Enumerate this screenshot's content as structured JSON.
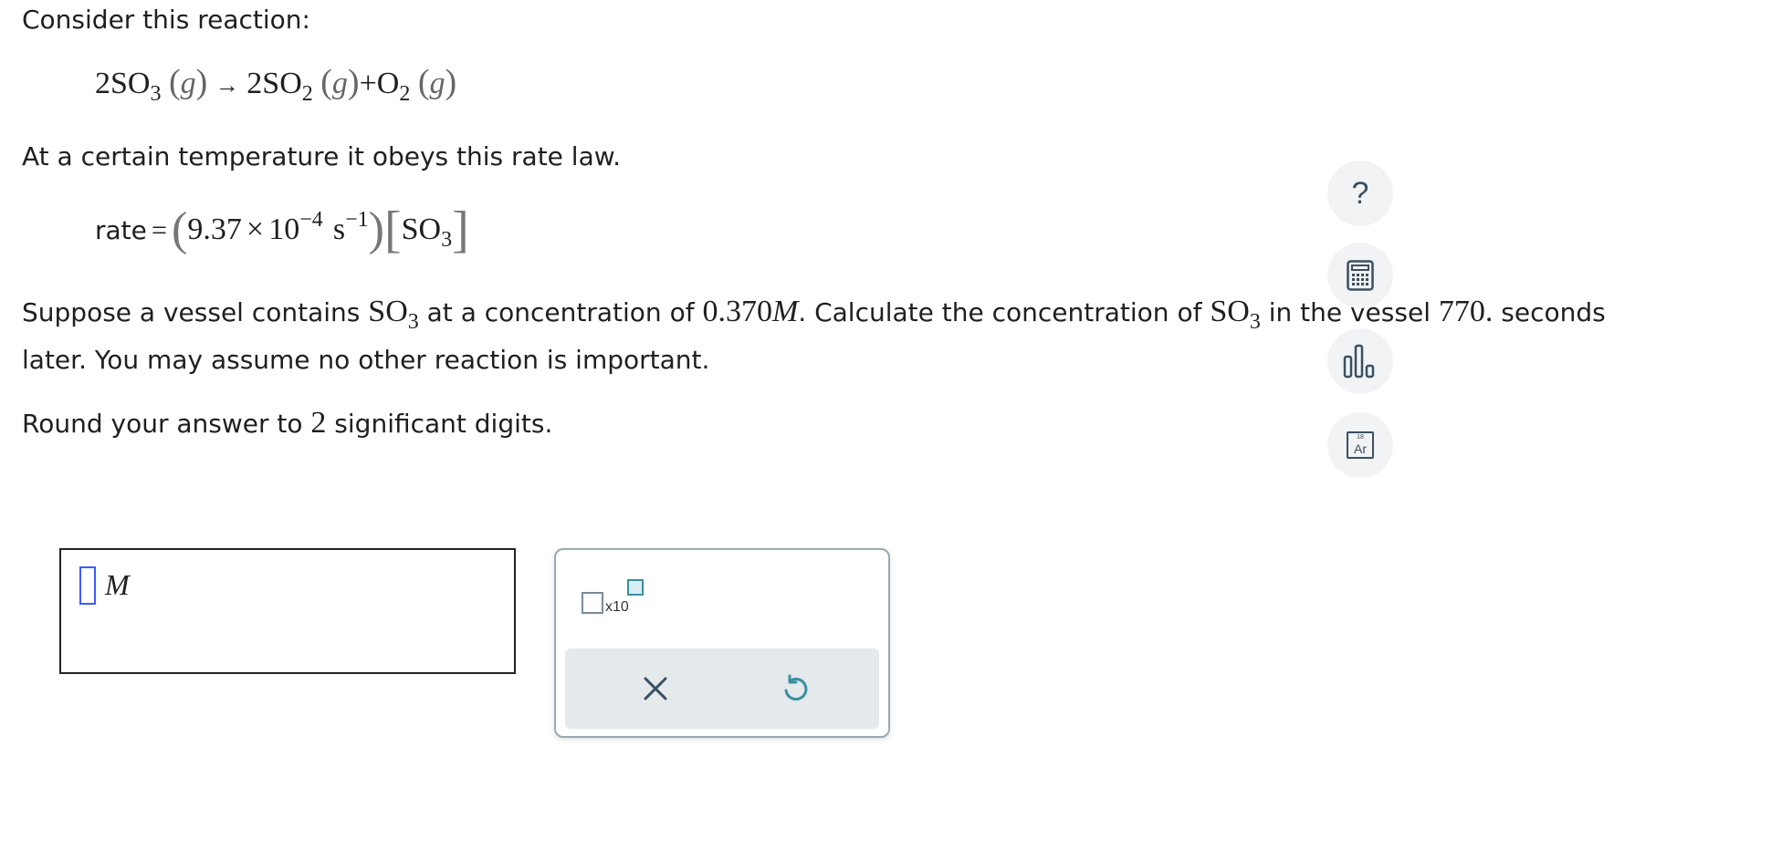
{
  "intro": "Consider this reaction:",
  "reaction": {
    "r_coef": "2",
    "r_species": "SO",
    "r_sub": "3",
    "phase": "g",
    "arrow": "→",
    "p1_coef": "2",
    "p1_species": "SO",
    "p1_sub": "2",
    "plus": "+",
    "p2_species": "O",
    "p2_sub": "2"
  },
  "rate_intro": "At a certain temperature it obeys this rate law.",
  "rate_law": {
    "label": "rate",
    "equals": "=",
    "k_mantissa": "9.37",
    "times": "×",
    "ten": "10",
    "k_exp": "−4",
    "unit": "s",
    "unit_exp": "−1",
    "species": "SO",
    "species_sub": "3"
  },
  "question": {
    "p1": "Suppose a vessel contains ",
    "species": "SO",
    "species_sub": "3",
    "p2": " at a concentration of ",
    "conc": "0.370",
    "conc_unit": "M",
    "p3": ". Calculate the concentration of ",
    "p4": " in the vessel ",
    "time": "770.",
    "p5": " seconds",
    "line2": "later. You may assume no other reaction is important."
  },
  "rounding": {
    "p1": "Round your answer to ",
    "digits": "2",
    "p2": " significant digits."
  },
  "answer": {
    "value": "",
    "unit": "M"
  },
  "palette": {
    "sci_label": "x10"
  },
  "tools": {
    "help": "?",
    "periodic_number": "18",
    "periodic_symbol": "Ar"
  },
  "colors": {
    "accent_cursor": "#3d5afe",
    "tool_bg": "#f1f3f4",
    "palette_bar": "#e4e9ec",
    "icon": "#3a5060"
  }
}
